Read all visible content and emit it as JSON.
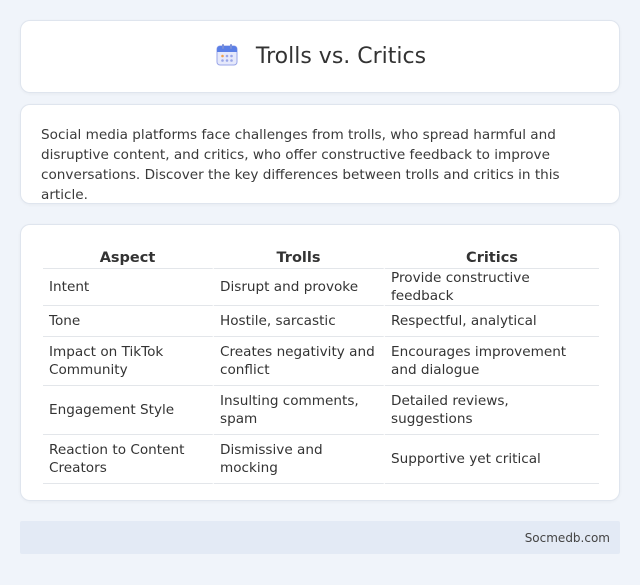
{
  "header": {
    "title": "Trolls vs. Critics",
    "icon": "calendar-icon"
  },
  "intro": "Social media platforms face challenges from trolls, who spread harmful and disruptive content, and critics, who offer constructive feedback to improve conversations. Discover the key differences between trolls and critics in this article.",
  "table": {
    "headers": [
      "Aspect",
      "Trolls",
      "Critics"
    ],
    "rows": [
      [
        "Intent",
        "Disrupt and provoke",
        "Provide constructive feedback"
      ],
      [
        "Tone",
        "Hostile, sarcastic",
        "Respectful, analytical"
      ],
      [
        "Impact on TikTok Community",
        "Creates negativity and conflict",
        "Encourages improvement and dialogue"
      ],
      [
        "Engagement Style",
        "Insulting comments, spam",
        "Detailed reviews, suggestions"
      ],
      [
        "Reaction to Content Creators",
        "Dismissive and mocking",
        "Supportive yet critical"
      ]
    ]
  },
  "footer": {
    "site": "Socmedb.com"
  }
}
